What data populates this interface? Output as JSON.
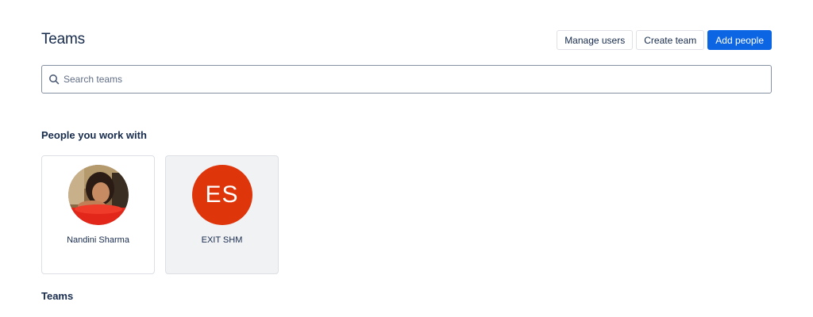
{
  "header": {
    "title": "Teams"
  },
  "actions": {
    "manage_users": "Manage users",
    "create_team": "Create team",
    "add_people": "Add people"
  },
  "search": {
    "placeholder": "Search teams",
    "value": ""
  },
  "people_section": {
    "heading": "People you work with",
    "people": [
      {
        "name": "Nandini Sharma",
        "avatar": "photo"
      },
      {
        "name": "EXIT SHM",
        "initials": "ES",
        "avatar_color": "#de350b"
      }
    ]
  },
  "teams_section": {
    "heading": "Teams"
  },
  "colors": {
    "primary": "#0c66e4",
    "text": "#172b4d",
    "avatar_orange": "#de350b"
  }
}
